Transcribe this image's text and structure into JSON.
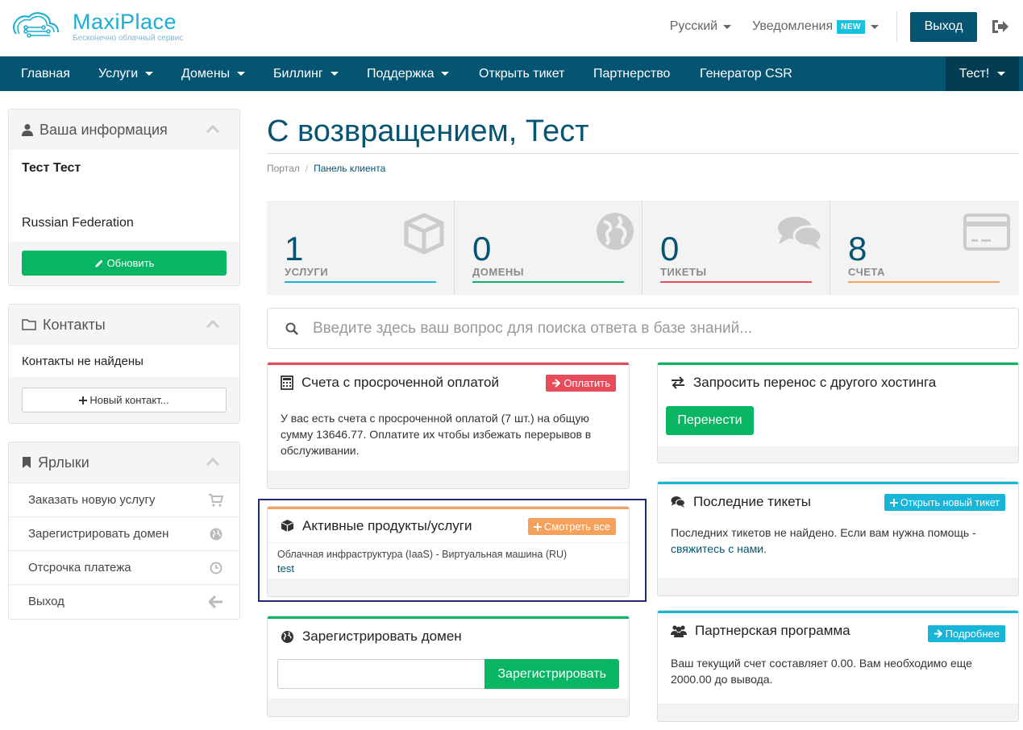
{
  "brand": {
    "name": "MaxiPlace",
    "tagline": "Бесконечно облачный сервис",
    "color": "#1aaed6"
  },
  "header": {
    "language": "Русский",
    "notifications": "Уведомления",
    "new_badge": "NEW",
    "logout": "Выход"
  },
  "nav": {
    "items": [
      "Главная",
      "Услуги",
      "Домены",
      "Биллинг",
      "Поддержка",
      "Открыть тикет",
      "Партнерство",
      "Генератор CSR"
    ],
    "user": "Тест!"
  },
  "sidebar": {
    "info": {
      "title": "Ваша информация",
      "name": "Тест Тест",
      "country": "Russian Federation",
      "update_button": "Обновить"
    },
    "contacts": {
      "title": "Контакты",
      "empty": "Контакты не найдены",
      "new_button": "Новый контакт..."
    },
    "shortcuts": {
      "title": "Ярлыки",
      "items": [
        {
          "label": "Заказать новую услугу",
          "icon": "cart-icon"
        },
        {
          "label": "Зарегистрировать домен",
          "icon": "globe-icon"
        },
        {
          "label": "Отсрочка платежа",
          "icon": "clock-icon"
        },
        {
          "label": "Выход",
          "icon": "arrow-left-icon"
        }
      ]
    }
  },
  "main": {
    "title": "С возвращением, Тест",
    "breadcrumb": [
      "Портал",
      "Панель клиента"
    ],
    "stats": [
      {
        "value": "1",
        "label": "УСЛУГИ",
        "color": "#17b6d9",
        "icon": "cube-icon"
      },
      {
        "value": "0",
        "label": "ДОМЕНЫ",
        "color": "#08b562",
        "icon": "globe-icon"
      },
      {
        "value": "0",
        "label": "ТИКЕТЫ",
        "color": "#e84c5a",
        "icon": "comments-icon"
      },
      {
        "value": "8",
        "label": "СЧЕТА",
        "color": "#f5a05b",
        "icon": "credit-card-icon"
      }
    ],
    "kb_search_placeholder": "Введите здесь ваш вопрос для поиска ответа в базе знаний...",
    "overdue": {
      "title": "Счета с просроченной оплатой",
      "button": "Оплатить",
      "text": "У вас есть счета с просроченной оплатой (7 шт.) на общую сумму 13646.77. Оплатите их чтобы избежать перерывов в обслуживании."
    },
    "products": {
      "title": "Активные продукты/услуги",
      "button": "Смотреть все",
      "product": "Облачная инфраструктура (IaaS) - Виртуальная машина (RU)",
      "product_link": "test"
    },
    "register_domain": {
      "title": "Зарегистрировать домен",
      "button": "Зарегистрировать",
      "input_value": ""
    },
    "transfer": {
      "title": "Запросить перенос с другого хостинга",
      "button": "Перенести"
    },
    "tickets": {
      "title": "Последние тикеты",
      "button": "Открыть новый тикет",
      "text": "Последних тикетов не найдено. Если вам нужна помощь -",
      "link": "свяжитесь с нами",
      "text_end": "."
    },
    "affiliate": {
      "title": "Партнерская программа",
      "button": "Подробнее",
      "text": "Ваш текущий счет составляет 0.00. Вам необходимо еще 2000.00 до вывода."
    }
  }
}
